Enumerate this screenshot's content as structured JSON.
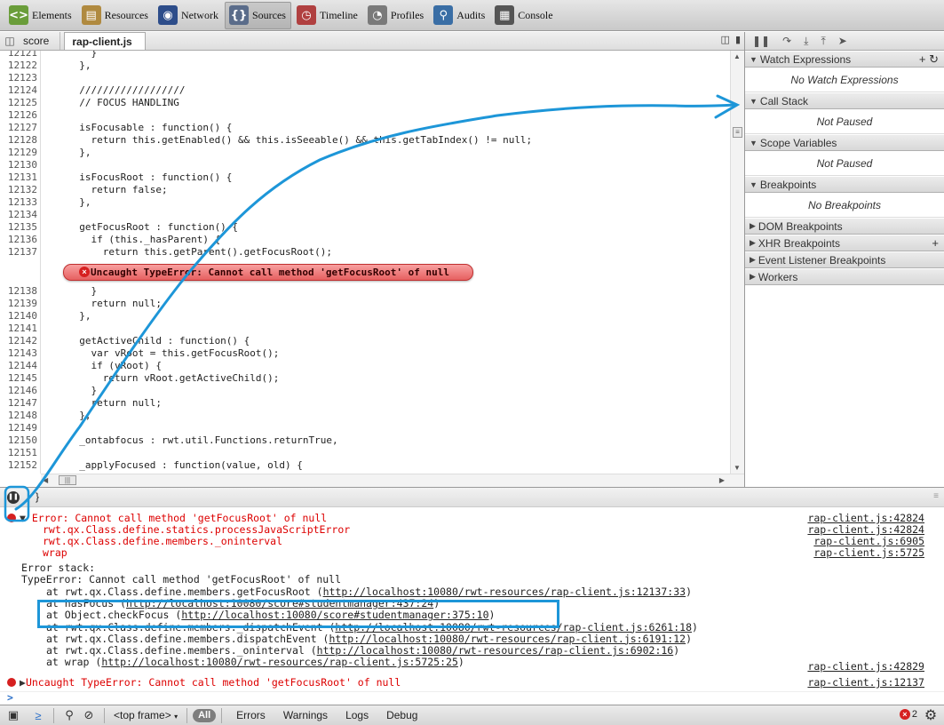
{
  "toolbar": {
    "tabs": [
      {
        "label": "Elements",
        "icon": "elements-icon",
        "color": "#6a9d3a"
      },
      {
        "label": "Resources",
        "icon": "resources-icon",
        "color": "#b08a40"
      },
      {
        "label": "Network",
        "icon": "network-icon",
        "color": "#2d4d8a"
      },
      {
        "label": "Sources",
        "icon": "sources-icon",
        "color": "#5a6c8a"
      },
      {
        "label": "Timeline",
        "icon": "timeline-icon",
        "color": "#b04040"
      },
      {
        "label": "Profiles",
        "icon": "profiles-icon",
        "color": "#7a7a7a"
      },
      {
        "label": "Audits",
        "icon": "audits-icon",
        "color": "#3a6ea5"
      },
      {
        "label": "Console",
        "icon": "console-icon",
        "color": "#555555"
      }
    ],
    "active": "Sources"
  },
  "file_tabs": {
    "inactive": "score",
    "active": "rap-client.js"
  },
  "code": {
    "lines": [
      {
        "n": "12121",
        "t": "    }"
      },
      {
        "n": "12122",
        "t": "  },"
      },
      {
        "n": "12123",
        "t": ""
      },
      {
        "n": "12124",
        "t": "  //////////////////"
      },
      {
        "n": "12125",
        "t": "  // FOCUS HANDLING"
      },
      {
        "n": "12126",
        "t": ""
      },
      {
        "n": "12127",
        "t": "  isFocusable : function() {"
      },
      {
        "n": "12128",
        "t": "    return this.getEnabled() && this.isSeeable() && this.getTabIndex() != null;"
      },
      {
        "n": "12129",
        "t": "  },"
      },
      {
        "n": "12130",
        "t": ""
      },
      {
        "n": "12131",
        "t": "  isFocusRoot : function() {"
      },
      {
        "n": "12132",
        "t": "    return false;"
      },
      {
        "n": "12133",
        "t": "  },"
      },
      {
        "n": "12134",
        "t": ""
      },
      {
        "n": "12135",
        "t": "  getFocusRoot : function() {"
      },
      {
        "n": "12136",
        "t": "    if (this._hasParent) {"
      },
      {
        "n": "12137",
        "t": "      return this.getParent().getFocusRoot();"
      }
    ],
    "lines_after": [
      {
        "n": "12138",
        "t": "    }"
      },
      {
        "n": "12139",
        "t": "    return null;"
      },
      {
        "n": "12140",
        "t": "  },"
      },
      {
        "n": "12141",
        "t": ""
      },
      {
        "n": "12142",
        "t": "  getActiveChild : function() {"
      },
      {
        "n": "12143",
        "t": "    var vRoot = this.getFocusRoot();"
      },
      {
        "n": "12144",
        "t": "    if (vRoot) {"
      },
      {
        "n": "12145",
        "t": "      return vRoot.getActiveChild();"
      },
      {
        "n": "12146",
        "t": "    }"
      },
      {
        "n": "12147",
        "t": "    return null;"
      },
      {
        "n": "12148",
        "t": "  },"
      },
      {
        "n": "12149",
        "t": ""
      },
      {
        "n": "12150",
        "t": "  _ontabfocus : rwt.util.Functions.returnTrue,"
      },
      {
        "n": "12151",
        "t": ""
      },
      {
        "n": "12152",
        "t": "  _applyFocused : function(value, old) {"
      }
    ],
    "error_bubble": "Uncaught TypeError: Cannot call method 'getFocusRoot' of null"
  },
  "right_panel": {
    "sections": [
      {
        "title": "Watch Expressions",
        "expanded": true,
        "body": "No Watch Expressions",
        "actions": [
          "+",
          "↻"
        ]
      },
      {
        "title": "Call Stack",
        "expanded": true,
        "body": "Not Paused"
      },
      {
        "title": "Scope Variables",
        "expanded": true,
        "body": "Not Paused"
      },
      {
        "title": "Breakpoints",
        "expanded": true,
        "body": "No Breakpoints"
      },
      {
        "title": "DOM Breakpoints",
        "expanded": false
      },
      {
        "title": "XHR Breakpoints",
        "expanded": false,
        "actions": [
          "+"
        ]
      },
      {
        "title": "Event Listener Breakpoints",
        "expanded": false
      },
      {
        "title": "Workers",
        "expanded": false
      }
    ]
  },
  "console": {
    "error1": {
      "head": "Error: Cannot call method 'getFocusRoot' of null",
      "head_src": "rap-client.js:42824",
      "frames": [
        {
          "t": "rwt.qx.Class.define.statics.processJavaScriptError",
          "src": "rap-client.js:42824"
        },
        {
          "t": "rwt.qx.Class.define.members._oninterval",
          "src": "rap-client.js:6905"
        },
        {
          "t": "wrap",
          "src": "rap-client.js:5725"
        }
      ]
    },
    "stack_label": "Error stack:",
    "stack_error": "TypeError: Cannot call method 'getFocusRoot' of null",
    "stack": [
      {
        "pre": "at rwt.qx.Class.define.members.getFocusRoot (",
        "url": "http://localhost:10080/rwt-resources/rap-client.js:12137:33",
        "post": ")"
      },
      {
        "pre": "at hasFocus (",
        "url": "http://localhost:10080/score#studentmanager:437:24",
        "post": ")"
      },
      {
        "pre": "at Object.checkFocus (",
        "url": "http://localhost:10080/score#studentmanager:375:10",
        "post": ")"
      },
      {
        "pre": "at rwt.qx.Class.define.members._dispatchEvent (",
        "url": "http://localhost:10080/rwt-resources/rap-client.js:6261:18",
        "post": ")"
      },
      {
        "pre": "at rwt.qx.Class.define.members.dispatchEvent (",
        "url": "http://localhost:10080/rwt-resources/rap-client.js:6191:12",
        "post": ")"
      },
      {
        "pre": "at rwt.qx.Class.define.members._oninterval (",
        "url": "http://localhost:10080/rwt-resources/rap-client.js:6902:16",
        "post": ")"
      },
      {
        "pre": "at wrap (",
        "url": "http://localhost:10080/rwt-resources/rap-client.js:5725:25",
        "post": ")"
      }
    ],
    "stack_last_src": "rap-client.js:42829",
    "error2": {
      "text": "Uncaught TypeError: Cannot call method 'getFocusRoot' of null",
      "src": "rap-client.js:12137"
    },
    "prompt": ">"
  },
  "status_bar": {
    "frame": "<top frame>",
    "all": "All",
    "filters": [
      "Errors",
      "Warnings",
      "Logs",
      "Debug"
    ],
    "error_count": "2"
  },
  "colors": {
    "annotation": "#1d96d8",
    "error": "#d00000"
  }
}
